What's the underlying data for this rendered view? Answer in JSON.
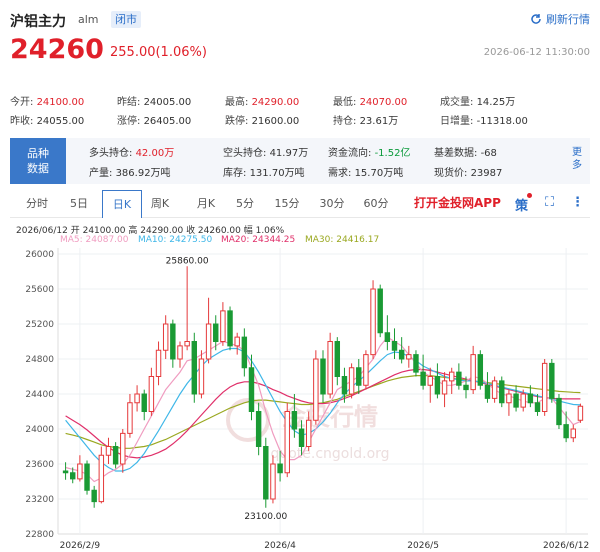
{
  "header": {
    "name": "沪铝主力",
    "code": "alm",
    "status": "闭市",
    "refresh": "刷新行情",
    "price": "24260",
    "change": "255.00(1.06%)",
    "time": "2026-06-12 11:30:00"
  },
  "stats": [
    {
      "k": "今开: ",
      "v": "24100.00",
      "c": "red"
    },
    {
      "k": "昨结: ",
      "v": "24005.00",
      "c": ""
    },
    {
      "k": "最高: ",
      "v": "24290.00",
      "c": "red"
    },
    {
      "k": "最低: ",
      "v": "24070.00",
      "c": "red"
    },
    {
      "k": "成交量: ",
      "v": "14.25万",
      "c": ""
    },
    {
      "k": "昨收: ",
      "v": "24055.00",
      "c": ""
    },
    {
      "k": "涨停: ",
      "v": "26405.00",
      "c": ""
    },
    {
      "k": "跌停: ",
      "v": "21600.00",
      "c": ""
    },
    {
      "k": "持仓: ",
      "v": "23.61万",
      "c": ""
    },
    {
      "k": "日增量: ",
      "v": "-11318.00",
      "c": ""
    }
  ],
  "band": {
    "label1": "品种",
    "label2": "数据",
    "more1": "更",
    "more2": "多",
    "items": [
      {
        "k": "多头持仓: ",
        "v": "42.00万",
        "c": "red"
      },
      {
        "k": "空头持仓: ",
        "v": "41.97万",
        "c": ""
      },
      {
        "k": "资金流向: ",
        "v": "-1.52亿",
        "c": "green"
      },
      {
        "k": "基差数据: ",
        "v": "-68",
        "c": ""
      },
      {
        "k": "产量: ",
        "v": "386.92万吨",
        "c": ""
      },
      {
        "k": "库存: ",
        "v": "131.70万吨",
        "c": ""
      },
      {
        "k": "需求: ",
        "v": "15.70万吨",
        "c": ""
      },
      {
        "k": "现货价: ",
        "v": "23987",
        "c": ""
      }
    ]
  },
  "tabs": [
    "分时",
    "5日",
    "日K",
    "周K",
    "月K",
    "5分",
    "15分",
    "30分",
    "60分"
  ],
  "active_tab": "日K",
  "app_link": "打开金投网APP",
  "chart_info": "2026/06/12  开 24100.00  高 24290.00  收 24260.00  幅 1.06%",
  "ma_labels": [
    {
      "t": "MA5: 24087.00",
      "color": "#f09cc0"
    },
    {
      "t": "MA10: 24275.50",
      "color": "#3fb7e8"
    },
    {
      "t": "MA20: 24344.25",
      "color": "#e0306a"
    },
    {
      "t": "MA30: 24416.17",
      "color": "#9aa820"
    }
  ],
  "watermark": "金投行情",
  "watermark_url": "quote.cngold.org",
  "chart_data": {
    "type": "candlestick",
    "ylim": [
      22800,
      26000
    ],
    "yticks": [
      26000,
      25600,
      25200,
      24800,
      24400,
      24000,
      23600,
      23200,
      22800
    ],
    "xticks": [
      "2026/2/9",
      "2026/4",
      "2026/5",
      "2026/6/12"
    ],
    "annotations": [
      {
        "text": "25860.00",
        "value": 25860
      },
      {
        "text": "23100.00",
        "value": 23100
      }
    ],
    "candles": [
      [
        23520,
        23620,
        23420,
        23500
      ],
      [
        23500,
        23560,
        23380,
        23430
      ],
      [
        23430,
        23700,
        23400,
        23600
      ],
      [
        23600,
        23640,
        23250,
        23300
      ],
      [
        23300,
        23350,
        23100,
        23170
      ],
      [
        23170,
        23800,
        23150,
        23700
      ],
      [
        23700,
        23900,
        23600,
        23800
      ],
      [
        23800,
        23850,
        23550,
        23600
      ],
      [
        23600,
        24000,
        23500,
        23950
      ],
      [
        23950,
        24400,
        23900,
        24300
      ],
      [
        24300,
        24500,
        24200,
        24400
      ],
      [
        24400,
        24450,
        24100,
        24200
      ],
      [
        24200,
        24700,
        24150,
        24600
      ],
      [
        24600,
        25000,
        24500,
        24900
      ],
      [
        24900,
        25300,
        24800,
        25200
      ],
      [
        25200,
        25250,
        24700,
        24800
      ],
      [
        24800,
        25000,
        24700,
        24950
      ],
      [
        24950,
        25860,
        24900,
        25000
      ],
      [
        25000,
        25100,
        24300,
        24400
      ],
      [
        24400,
        24900,
        24350,
        24800
      ],
      [
        24800,
        25500,
        24750,
        25200
      ],
      [
        25200,
        25300,
        24900,
        25000
      ],
      [
        25000,
        25450,
        24950,
        25350
      ],
      [
        25350,
        25400,
        24900,
        24950
      ],
      [
        24950,
        25100,
        24850,
        25050
      ],
      [
        25050,
        25150,
        24600,
        24700
      ],
      [
        24700,
        24850,
        24100,
        24200
      ],
      [
        24200,
        24300,
        23700,
        23800
      ],
      [
        23800,
        23900,
        23100,
        23200
      ],
      [
        23200,
        23700,
        23150,
        23600
      ],
      [
        23600,
        23750,
        23400,
        23500
      ],
      [
        23500,
        24300,
        23450,
        24200
      ],
      [
        24200,
        24400,
        23900,
        24000
      ],
      [
        24000,
        24100,
        23700,
        23800
      ],
      [
        23800,
        24200,
        23750,
        24100
      ],
      [
        24100,
        24900,
        24050,
        24800
      ],
      [
        24800,
        24900,
        24300,
        24400
      ],
      [
        24400,
        25100,
        24350,
        25000
      ],
      [
        25000,
        25050,
        24500,
        24600
      ],
      [
        24600,
        24700,
        24300,
        24400
      ],
      [
        24400,
        24750,
        24350,
        24700
      ],
      [
        24700,
        24800,
        24400,
        24500
      ],
      [
        24500,
        24900,
        24450,
        24850
      ],
      [
        24850,
        25700,
        24800,
        25600
      ],
      [
        25600,
        25650,
        25050,
        25100
      ],
      [
        25100,
        25300,
        24900,
        25000
      ],
      [
        25000,
        25150,
        24800,
        24900
      ],
      [
        24900,
        25050,
        24750,
        24800
      ],
      [
        24800,
        24950,
        24700,
        24850
      ],
      [
        24850,
        24900,
        24600,
        24650
      ],
      [
        24650,
        24850,
        24450,
        24500
      ],
      [
        24500,
        24700,
        24300,
        24600
      ],
      [
        24600,
        24750,
        24350,
        24400
      ],
      [
        24400,
        24650,
        24250,
        24550
      ],
      [
        24550,
        24700,
        24400,
        24650
      ],
      [
        24650,
        24750,
        24450,
        24500
      ],
      [
        24500,
        24600,
        24350,
        24450
      ],
      [
        24450,
        24950,
        24400,
        24850
      ],
      [
        24850,
        24900,
        24450,
        24500
      ],
      [
        24500,
        24650,
        24300,
        24350
      ],
      [
        24350,
        24600,
        24300,
        24550
      ],
      [
        24550,
        24600,
        24250,
        24300
      ],
      [
        24300,
        24450,
        24150,
        24400
      ],
      [
        24400,
        24500,
        24200,
        24250
      ],
      [
        24250,
        24450,
        24200,
        24400
      ],
      [
        24400,
        24500,
        24250,
        24300
      ],
      [
        24300,
        24400,
        24150,
        24200
      ],
      [
        24200,
        24800,
        24150,
        24750
      ],
      [
        24750,
        24800,
        24300,
        24350
      ],
      [
        24350,
        24400,
        24000,
        24050
      ],
      [
        24050,
        24200,
        23850,
        23900
      ],
      [
        23900,
        24050,
        23850,
        24000
      ],
      [
        24100,
        24290,
        24070,
        24260
      ]
    ],
    "ma5": [
      23560,
      23540,
      23520,
      23480,
      23400,
      23440,
      23500,
      23540,
      23600,
      23700,
      23850,
      24000,
      24150,
      24300,
      24450,
      24550,
      24650,
      24780,
      24800,
      24850,
      24900,
      24950,
      25000,
      24980,
      24950,
      24900,
      24700,
      24500,
      24200,
      23950,
      23750,
      23650,
      23650,
      23700,
      23850,
      24000,
      24150,
      24300,
      24450,
      24500,
      24550,
      24600,
      24700,
      24800,
      24950,
      25050,
      25000,
      24950,
      24850,
      24750,
      24650,
      24600,
      24550,
      24500,
      24500,
      24520,
      24550,
      24600,
      24580,
      24520,
      24450,
      24400,
      24380,
      24350,
      24320,
      24300,
      24300,
      24350,
      24350,
      24250,
      24150,
      24050,
      24087
    ],
    "ma10": [
      24100,
      24000,
      23900,
      23800,
      23700,
      23620,
      23560,
      23520,
      23520,
      23550,
      23620,
      23720,
      23850,
      23980,
      24120,
      24260,
      24400,
      24520,
      24620,
      24720,
      24800,
      24850,
      24900,
      24920,
      24920,
      24880,
      24780,
      24650,
      24500,
      24350,
      24200,
      24080,
      23980,
      23930,
      23950,
      24000,
      24080,
      24180,
      24300,
      24400,
      24480,
      24550,
      24620,
      24700,
      24780,
      24850,
      24880,
      24870,
      24830,
      24780,
      24720,
      24680,
      24640,
      24600,
      24580,
      24560,
      24550,
      24550,
      24540,
      24520,
      24500,
      24480,
      24460,
      24440,
      24420,
      24400,
      24380,
      24360,
      24340,
      24320,
      24300,
      24280,
      24275
    ],
    "ma20": [
      24150,
      24100,
      24050,
      23990,
      23920,
      23850,
      23790,
      23740,
      23700,
      23680,
      23670,
      23680,
      23700,
      23730,
      23770,
      23830,
      23900,
      23980,
      24070,
      24160,
      24250,
      24340,
      24420,
      24480,
      24520,
      24540,
      24540,
      24520,
      24490,
      24450,
      24420,
      24380,
      24350,
      24320,
      24300,
      24290,
      24290,
      24300,
      24320,
      24350,
      24380,
      24420,
      24460,
      24500,
      24540,
      24580,
      24620,
      24650,
      24670,
      24680,
      24680,
      24670,
      24650,
      24630,
      24610,
      24590,
      24570,
      24550,
      24530,
      24510,
      24490,
      24470,
      24450,
      24430,
      24410,
      24390,
      24370,
      24360,
      24350,
      24345,
      24344,
      24344,
      24344
    ],
    "ma30": [
      23950,
      23930,
      23910,
      23880,
      23850,
      23820,
      23800,
      23790,
      23780,
      23780,
      23790,
      23800,
      23820,
      23850,
      23880,
      23920,
      23960,
      24000,
      24040,
      24080,
      24120,
      24160,
      24200,
      24240,
      24270,
      24300,
      24320,
      24330,
      24330,
      24320,
      24310,
      24300,
      24290,
      24280,
      24280,
      24290,
      24300,
      24320,
      24340,
      24370,
      24400,
      24430,
      24460,
      24490,
      24520,
      24550,
      24570,
      24590,
      24600,
      24610,
      24610,
      24610,
      24600,
      24590,
      24580,
      24570,
      24560,
      24550,
      24540,
      24530,
      24520,
      24510,
      24500,
      24490,
      24480,
      24470,
      24460,
      24450,
      24440,
      24430,
      24425,
      24420,
      24416
    ]
  }
}
